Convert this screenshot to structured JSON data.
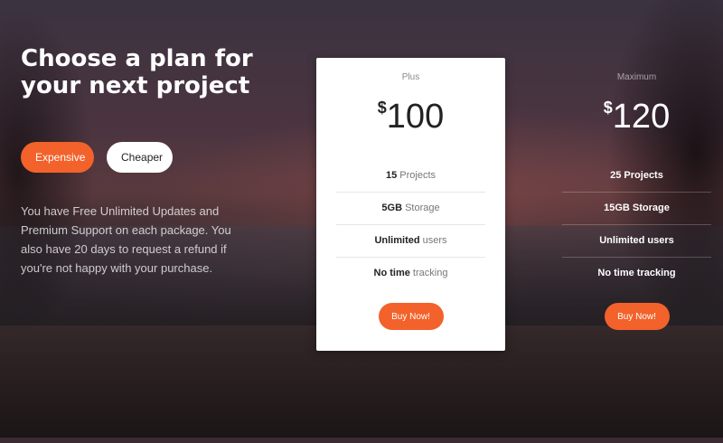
{
  "hero": {
    "title_line1": "Choose a plan for",
    "title_line2": "your next project",
    "toggle": {
      "expensive": "Expensive",
      "cheaper": "Cheaper"
    },
    "description": "You have Free Unlimited Updates and Premium Support on each package. You also have 20 days to request a refund if you're not happy with your purchase."
  },
  "plans": [
    {
      "name": "Plus",
      "currency": "$",
      "price": "100",
      "features": [
        {
          "bold": "15",
          "text": " Projects"
        },
        {
          "bold": "5GB",
          "text": " Storage"
        },
        {
          "bold": "Unlimited",
          "text": " users"
        },
        {
          "bold": "No time",
          "text": " tracking"
        }
      ],
      "button": "Buy Now!"
    },
    {
      "name": "Maximum",
      "currency": "$",
      "price": "120",
      "features": [
        {
          "bold": "",
          "text": "25 Projects"
        },
        {
          "bold": "",
          "text": "15GB Storage"
        },
        {
          "bold": "",
          "text": "Unlimited users"
        },
        {
          "bold": "",
          "text": "No time tracking"
        }
      ],
      "button": "Buy Now!"
    }
  ],
  "colors": {
    "accent": "#f2622a",
    "card_bg": "#ffffff"
  }
}
